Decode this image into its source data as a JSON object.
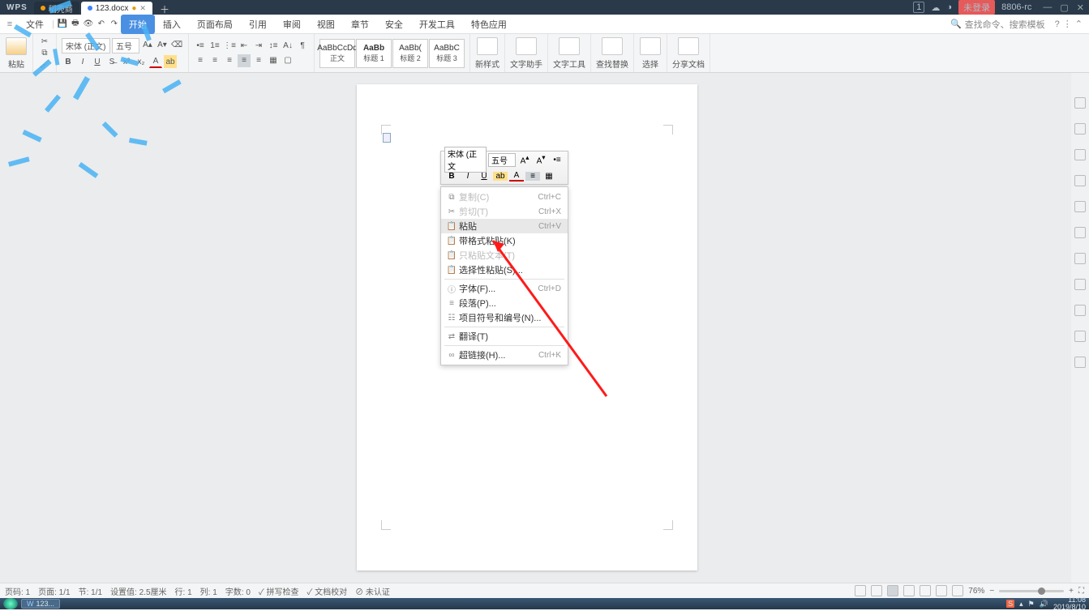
{
  "titlebar": {
    "app": "WPS",
    "tabs": [
      {
        "name": "稻壳商",
        "dot": "orange"
      },
      {
        "name": "123.docx",
        "dot": "blue"
      }
    ]
  },
  "topright": {
    "unlogin": "未登录",
    "build": "8806-rc"
  },
  "menubar": {
    "file": "文件",
    "items": [
      "开始",
      "插入",
      "页面布局",
      "引用",
      "审阅",
      "视图",
      "章节",
      "安全",
      "开发工具",
      "特色应用"
    ],
    "search_ph": "查找命令、搜索模板"
  },
  "ribbon": {
    "paste": "粘贴",
    "font_name": "宋体 (正文)",
    "font_size": "五号",
    "style_labels": [
      "正文",
      "标题 1",
      "标题 2",
      "标题 3"
    ],
    "style_previews": [
      "AaBbCcDd",
      "AaBb",
      "AaBb(",
      "AaBbC"
    ],
    "newstyle": "新样式",
    "doctool": "文字助手",
    "texttools": "文字工具",
    "findrep": "查找替换",
    "select": "选择",
    "share": "分享文档"
  },
  "mini": {
    "font": "宋体 (正文",
    "size": "五号"
  },
  "ctx": [
    {
      "ico": "⧉",
      "lbl": "复制(C)",
      "sc": "Ctrl+C",
      "dis": true
    },
    {
      "ico": "✂",
      "lbl": "剪切(T)",
      "sc": "Ctrl+X",
      "dis": true
    },
    {
      "ico": "📋",
      "lbl": "粘贴",
      "sc": "Ctrl+V",
      "hl": true
    },
    {
      "ico": "📋",
      "lbl": "带格式粘贴(K)"
    },
    {
      "ico": "📋",
      "lbl": "只粘贴文本(T)",
      "dis": true
    },
    {
      "ico": "📋",
      "lbl": "选择性粘贴(S)..."
    },
    {
      "sep": true
    },
    {
      "ico": "ⓘ",
      "lbl": "字体(F)...",
      "sc": "Ctrl+D"
    },
    {
      "ico": "≡",
      "lbl": "段落(P)..."
    },
    {
      "ico": "☷",
      "lbl": "项目符号和编号(N)..."
    },
    {
      "sep": true
    },
    {
      "ico": "⇄",
      "lbl": "翻译(T)"
    },
    {
      "sep": true
    },
    {
      "ico": "∞",
      "lbl": "超链接(H)...",
      "sc": "Ctrl+K"
    }
  ],
  "status": {
    "page": "页码: 1",
    "pages": "页面: 1/1",
    "sect": "节: 1/1",
    "setval": "设置值: 2.5厘米",
    "row": "行: 1",
    "col": "列: 1",
    "chars": "字数: 0",
    "spell": "拼写检查",
    "proof": "文档校对",
    "auth": "未认证",
    "zoom": "76%"
  },
  "taskbar": {
    "app": "123...",
    "time": "11:08",
    "date": "2019/8/10"
  }
}
